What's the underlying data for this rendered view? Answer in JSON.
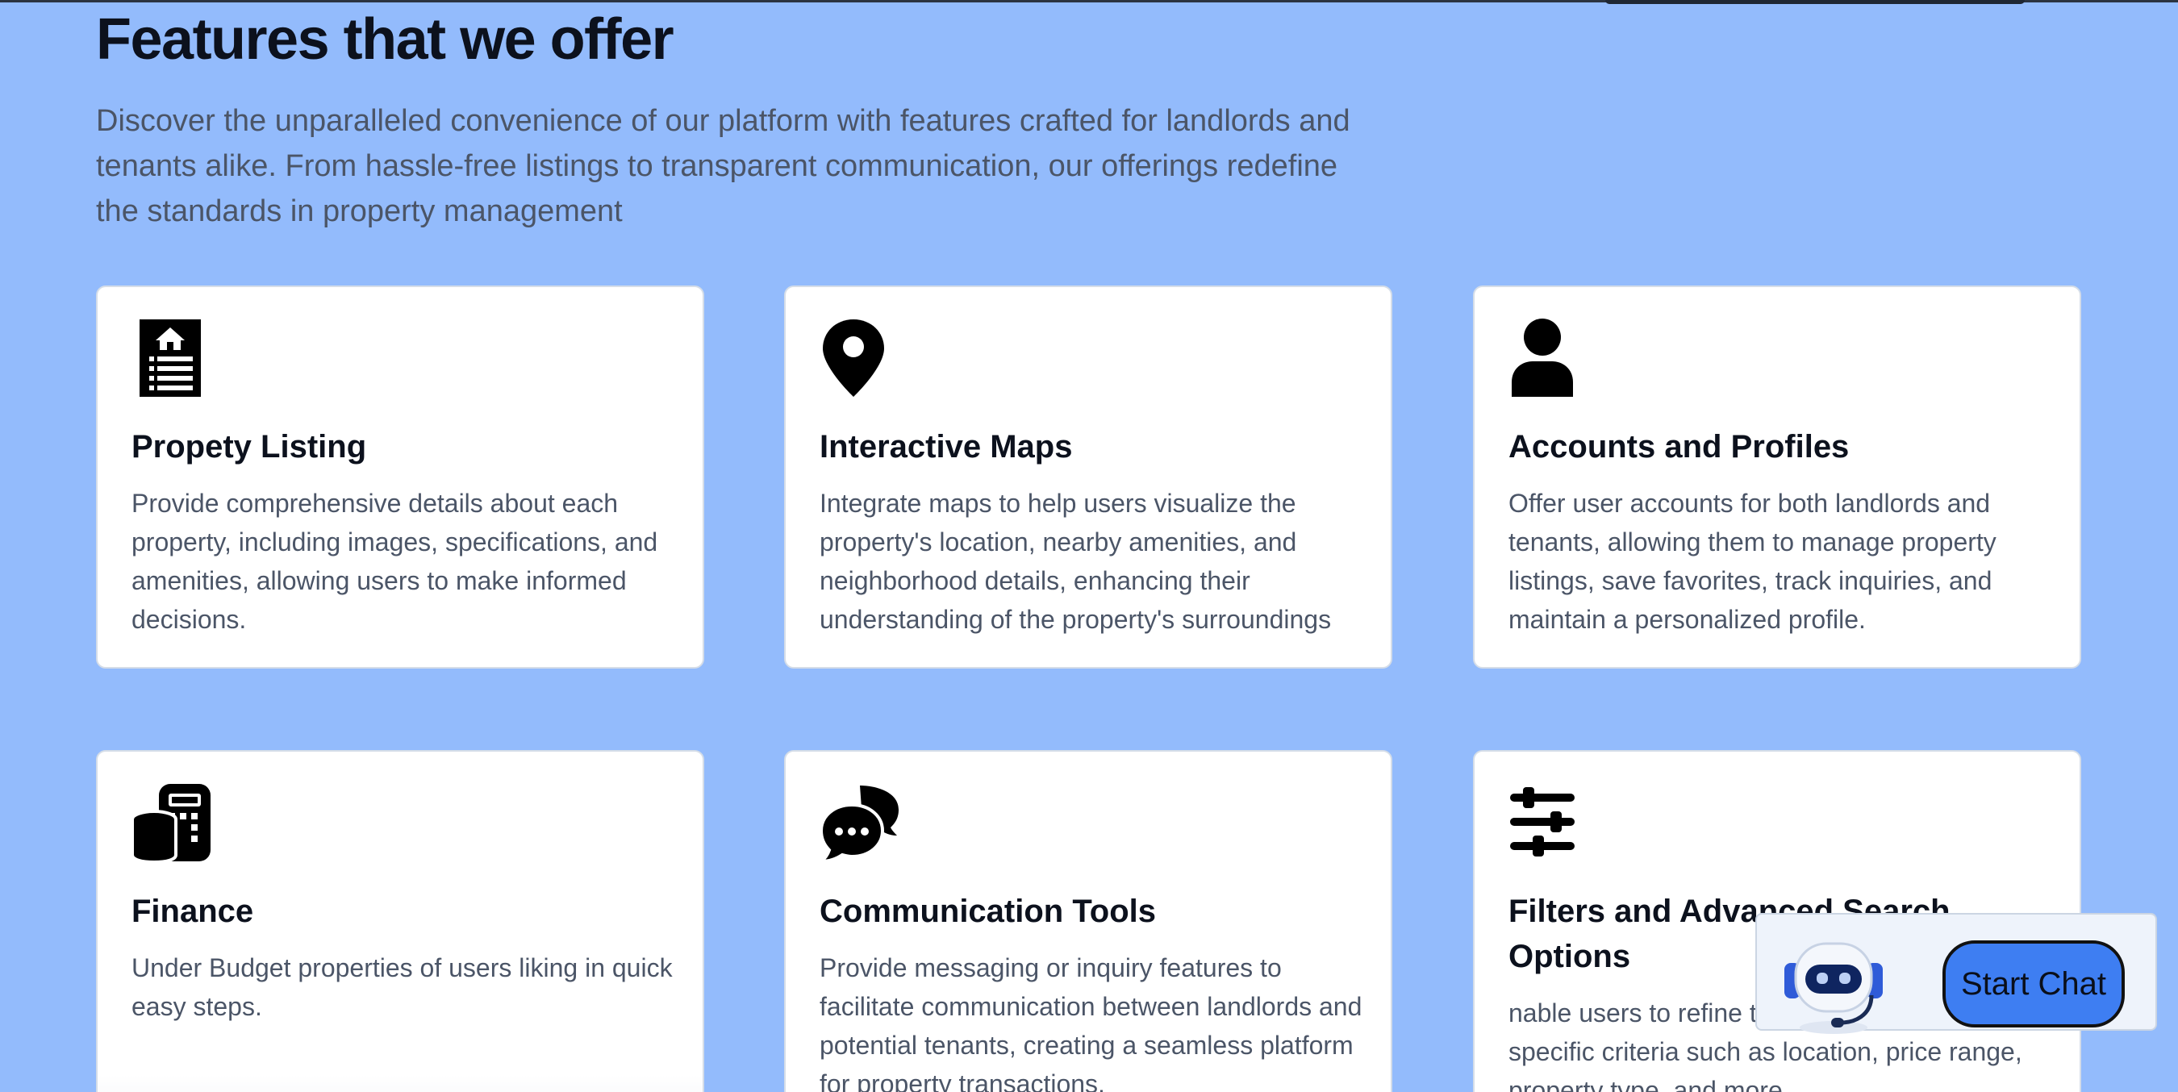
{
  "section": {
    "title": "Features that we offer",
    "intro": "Discover the unparalleled convenience of our platform with features crafted for landlords and tenants alike. From hassle-free listings to transparent communication, our offerings redefine the standards in property management"
  },
  "features": [
    {
      "icon": "property-listing-icon",
      "title": "Propety Listing",
      "description": "Provide comprehensive details about each property, including images, specifications, and amenities, allowing users to make informed decisions."
    },
    {
      "icon": "map-pin-icon",
      "title": "Interactive Maps",
      "description": "Integrate maps to help users visualize the property's location, nearby amenities, and neighborhood details, enhancing their understanding of the property's surroundings"
    },
    {
      "icon": "user-icon",
      "title": "Accounts and Profiles",
      "description": "Offer user accounts for both landlords and tenants, allowing them to manage property listings, save favorites, track inquiries, and maintain a personalized profile."
    },
    {
      "icon": "finance-icon",
      "title": "Finance",
      "description": "Under Budget properties of users liking in quick easy steps."
    },
    {
      "icon": "chat-bubbles-icon",
      "title": "Communication Tools",
      "description": "Provide messaging or inquiry features to facilitate communication between landlords and potential tenants, creating a seamless platform for property transactions."
    },
    {
      "icon": "sliders-icon",
      "title": "Filters and Advanced Search Options",
      "description": "nable users to refine their search based on specific criteria such as location, price range, property type, and more."
    }
  ],
  "chat": {
    "icon": "chatbot-icon",
    "button_label": "Start Chat"
  }
}
